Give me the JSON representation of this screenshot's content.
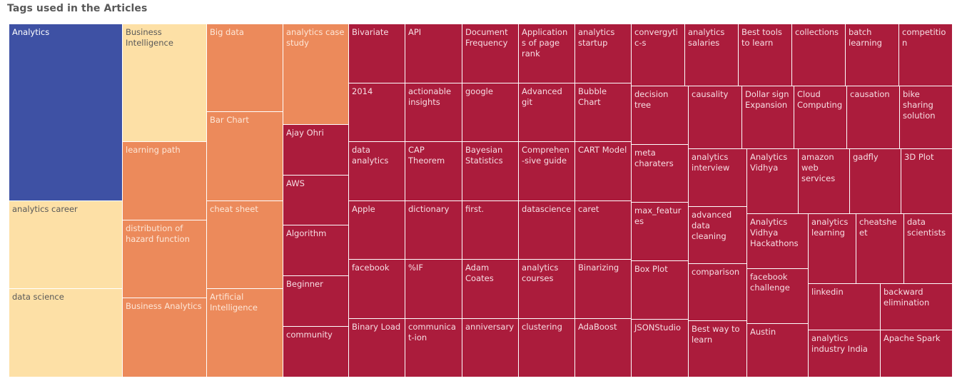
{
  "title": "Tags used in the Articles",
  "chart_data": {
    "type": "treemap",
    "title": "Tags used in the Articles",
    "colors": {
      "top": "#3e51a4",
      "high": "#fde0a6",
      "mid": "#ec8a5b",
      "low": "#ab1c3c"
    },
    "items": [
      {
        "label": "Analytics",
        "level": "top"
      },
      {
        "label": "analytics career",
        "level": "high"
      },
      {
        "label": "data science",
        "level": "high"
      },
      {
        "label": "Business Intelligence",
        "level": "high"
      },
      {
        "label": "learning path",
        "level": "mid"
      },
      {
        "label": "distribution of hazard function",
        "level": "mid"
      },
      {
        "label": "Business Analytics",
        "level": "mid"
      },
      {
        "label": "Big data",
        "level": "mid"
      },
      {
        "label": "Bar Chart",
        "level": "mid"
      },
      {
        "label": "cheat sheet",
        "level": "mid"
      },
      {
        "label": "Artificial Intelligence",
        "level": "mid"
      },
      {
        "label": "analytics case study",
        "level": "mid"
      },
      {
        "label": "Ajay Ohri",
        "level": "low"
      },
      {
        "label": "AWS",
        "level": "low"
      },
      {
        "label": "Algorithm",
        "level": "low"
      },
      {
        "label": "Beginner",
        "level": "low"
      },
      {
        "label": "community",
        "level": "low"
      },
      {
        "label": "Bivariate",
        "level": "low"
      },
      {
        "label": "API",
        "level": "low"
      },
      {
        "label": "Document Frequency",
        "level": "low"
      },
      {
        "label": "Applications of page rank",
        "level": "low"
      },
      {
        "label": "analytics startup",
        "level": "low"
      },
      {
        "label": "2014",
        "level": "low"
      },
      {
        "label": "actionable insights",
        "level": "low"
      },
      {
        "label": "google",
        "level": "low"
      },
      {
        "label": "Advanced git",
        "level": "low"
      },
      {
        "label": "Bubble Chart",
        "level": "low"
      },
      {
        "label": "data analytics",
        "level": "low"
      },
      {
        "label": "CAP Theorem",
        "level": "low"
      },
      {
        "label": "Bayesian Statistics",
        "level": "low"
      },
      {
        "label": "Comprehen-sive guide",
        "level": "low"
      },
      {
        "label": "CART Model",
        "level": "low"
      },
      {
        "label": "Apple",
        "level": "low"
      },
      {
        "label": "dictionary",
        "level": "low"
      },
      {
        "label": "first.",
        "level": "low"
      },
      {
        "label": "datascience",
        "level": "low"
      },
      {
        "label": "caret",
        "level": "low"
      },
      {
        "label": "facebook",
        "level": "low"
      },
      {
        "label": "%IF",
        "level": "low"
      },
      {
        "label": "Adam Coates",
        "level": "low"
      },
      {
        "label": "analytics courses",
        "level": "low"
      },
      {
        "label": "Binarizing",
        "level": "low"
      },
      {
        "label": "Binary Load",
        "level": "low"
      },
      {
        "label": "communicat-ion",
        "level": "low"
      },
      {
        "label": "anniversary",
        "level": "low"
      },
      {
        "label": "clustering",
        "level": "low"
      },
      {
        "label": "AdaBoost",
        "level": "low"
      },
      {
        "label": "convergytic-s",
        "level": "low"
      },
      {
        "label": "analytics salaries",
        "level": "low"
      },
      {
        "label": "Best tools to learn",
        "level": "low"
      },
      {
        "label": "collections",
        "level": "low"
      },
      {
        "label": "batch learning",
        "level": "low"
      },
      {
        "label": "competition",
        "level": "low"
      },
      {
        "label": "decision tree",
        "level": "low"
      },
      {
        "label": "causality",
        "level": "low"
      },
      {
        "label": "Dollar sign Expansion",
        "level": "low"
      },
      {
        "label": "Cloud Computing",
        "level": "low"
      },
      {
        "label": "causation",
        "level": "low"
      },
      {
        "label": "bike sharing solution",
        "level": "low"
      },
      {
        "label": "meta charaters",
        "level": "low"
      },
      {
        "label": "analytics interview",
        "level": "low"
      },
      {
        "label": "Analytics Vidhya",
        "level": "low"
      },
      {
        "label": "amazon web services",
        "level": "low"
      },
      {
        "label": "gadfly",
        "level": "low"
      },
      {
        "label": "3D Plot",
        "level": "low"
      },
      {
        "label": "max_features",
        "level": "low"
      },
      {
        "label": "advanced data cleaning",
        "level": "low"
      },
      {
        "label": "Analytics Vidhya Hackathons",
        "level": "low"
      },
      {
        "label": "analytics learning",
        "level": "low"
      },
      {
        "label": "cheatsheet",
        "level": "low"
      },
      {
        "label": "data scientists",
        "level": "low"
      },
      {
        "label": "Box Plot",
        "level": "low"
      },
      {
        "label": "comparison",
        "level": "low"
      },
      {
        "label": "facebook challenge",
        "level": "low"
      },
      {
        "label": "linkedin",
        "level": "low"
      },
      {
        "label": "backward elimination",
        "level": "low"
      },
      {
        "label": "JSONStudio",
        "level": "low"
      },
      {
        "label": "Best way to learn",
        "level": "low"
      },
      {
        "label": "Austin",
        "level": "low"
      },
      {
        "label": "analytics industry India",
        "level": "low"
      },
      {
        "label": "Apache Spark",
        "level": "low"
      }
    ]
  }
}
